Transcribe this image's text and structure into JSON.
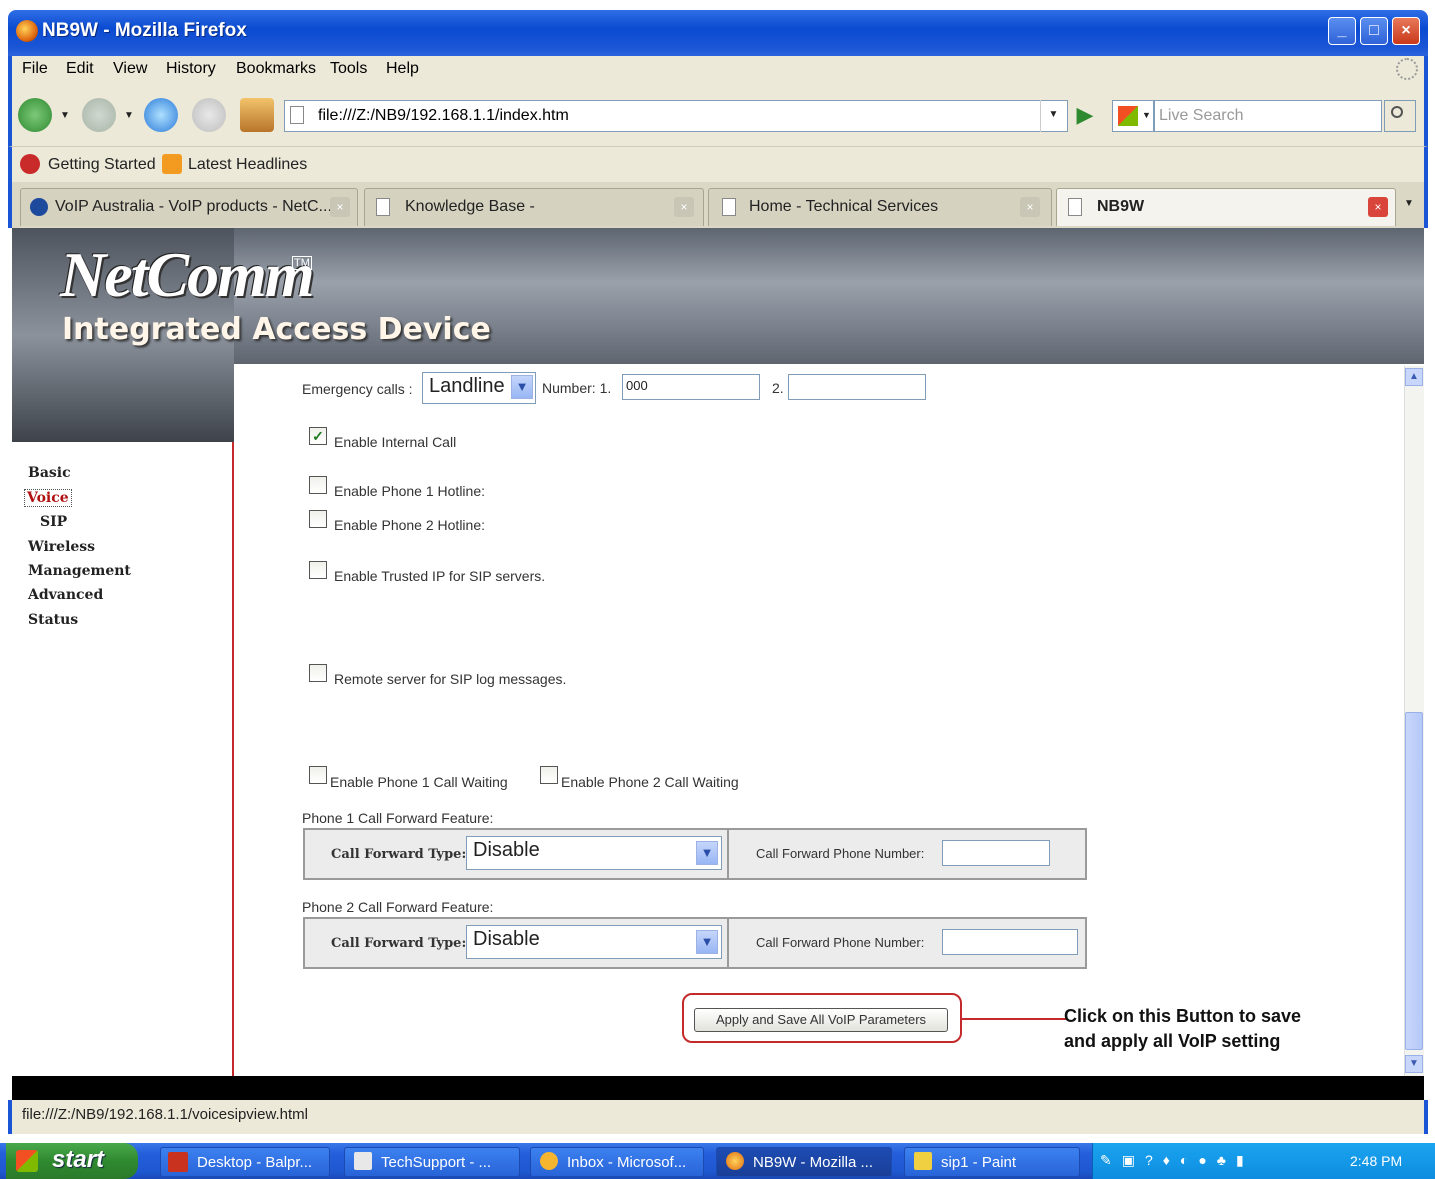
{
  "window": {
    "title": "NB9W - Mozilla Firefox"
  },
  "menu": [
    "File",
    "Edit",
    "View",
    "History",
    "Bookmarks",
    "Tools",
    "Help"
  ],
  "address": {
    "url": "file:///Z:/NB9/192.168.1.1/index.htm"
  },
  "search": {
    "placeholder": "Live Search"
  },
  "bookmarks": [
    "Getting Started",
    "Latest Headlines"
  ],
  "tabs": [
    {
      "label": "VoIP Australia - VoIP products - NetC..."
    },
    {
      "label": "Knowledge Base -"
    },
    {
      "label": "Home - Technical Services"
    },
    {
      "label": "NB9W"
    }
  ],
  "brand": {
    "logo": "NetComm",
    "tm": "TM",
    "tagline": "Integrated Access Device"
  },
  "sidebar": {
    "items": [
      "Basic",
      "Voice",
      "SIP",
      "Wireless",
      "Management",
      "Advanced",
      "Status"
    ],
    "active": "Voice"
  },
  "form": {
    "emergency_label": "Emergency calls :",
    "emergency_value": "Landline",
    "number1_label": "Number: 1.",
    "number1_value": "000",
    "number2_label": "2.",
    "number2_value": "",
    "internal_call": {
      "label": "Enable Internal Call",
      "checked": true
    },
    "hotline1": {
      "label": "Enable Phone 1 Hotline:",
      "checked": false
    },
    "hotline2": {
      "label": "Enable Phone 2 Hotline:",
      "checked": false
    },
    "trusted_ip": {
      "label": "Enable Trusted IP for SIP servers.",
      "checked": false
    },
    "remote_log": {
      "label": "Remote server for SIP log messages.",
      "checked": false
    },
    "cw1": {
      "label": "Enable Phone 1 Call Waiting",
      "checked": false
    },
    "cw2": {
      "label": "Enable Phone 2 Call Waiting",
      "checked": false
    },
    "phone1_cf_title": "Phone 1 Call Forward Feature:",
    "phone2_cf_title": "Phone 2 Call Forward Feature:",
    "cf_type_label": "Call Forward Type:",
    "cf_type_value": "Disable",
    "cf_number_label": "Call Forward Phone Number:",
    "apply_button": "Apply and Save All VoIP Parameters"
  },
  "annotation": {
    "line1": "Click on this Button to save",
    "line2": "and apply all VoIP setting",
    "color": "#c52a2a"
  },
  "status_bar": {
    "text": "file:///Z:/NB9/192.168.1.1/voicesipview.html"
  },
  "taskbar": {
    "start": "start",
    "items": [
      "Desktop - Balpr...",
      "TechSupport - ...",
      "Inbox - Microsof...",
      "NB9W - Mozilla ...",
      "sip1 - Paint"
    ],
    "active": "NB9W - Mozilla ...",
    "clock": "2:48 PM"
  }
}
